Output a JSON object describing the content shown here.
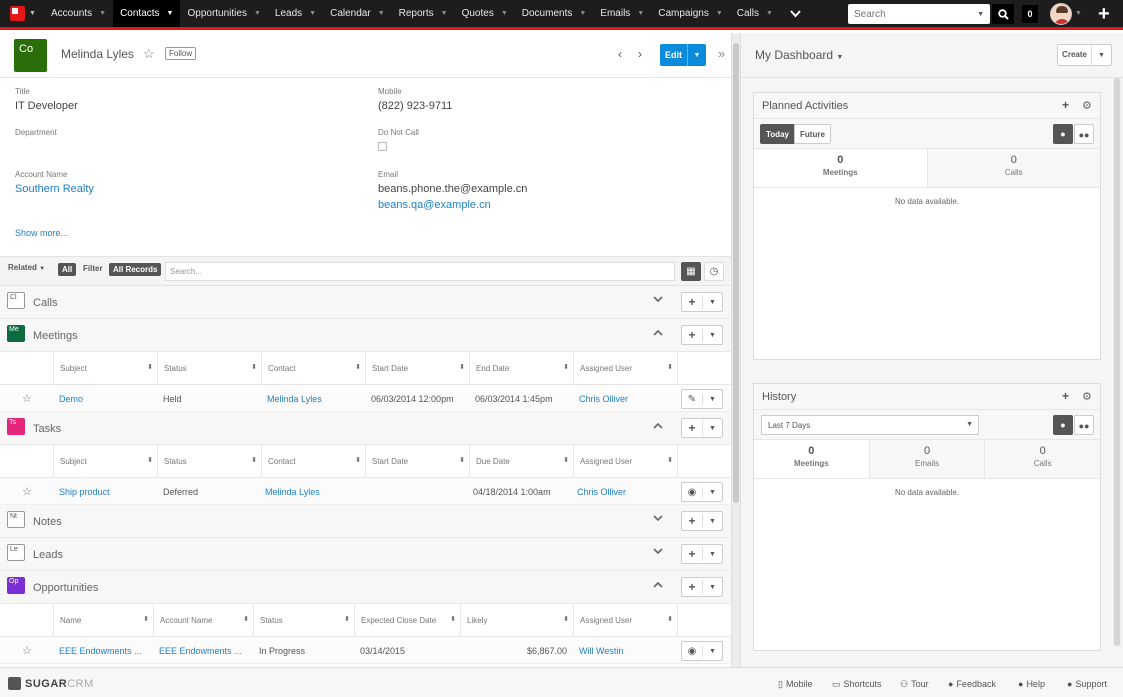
{
  "nav": {
    "items": [
      {
        "label": "Accounts",
        "active": false
      },
      {
        "label": "Contacts",
        "active": true
      },
      {
        "label": "Opportunities",
        "active": false
      },
      {
        "label": "Leads",
        "active": false
      },
      {
        "label": "Calendar",
        "active": false
      },
      {
        "label": "Reports",
        "active": false
      },
      {
        "label": "Quotes",
        "active": false
      },
      {
        "label": "Documents",
        "active": false
      },
      {
        "label": "Emails",
        "active": false
      },
      {
        "label": "Campaigns",
        "active": false
      },
      {
        "label": "Calls",
        "active": false
      }
    ],
    "search_placeholder": "Search",
    "notification_count": "0"
  },
  "record": {
    "badge": "Co",
    "name": "Melinda Lyles",
    "follow_label": "Follow",
    "edit_label": "Edit",
    "fields": {
      "title_label": "Title",
      "title_value": "IT Developer",
      "mobile_label": "Mobile",
      "mobile_value": "(822) 923-9711",
      "department_label": "Department",
      "do_not_call_label": "Do Not Call",
      "account_label": "Account Name",
      "account_value": "Southern Realty",
      "email_label": "Email",
      "email_1": "beans.phone.the@example.cn",
      "email_2": "beans.qa@example.cn"
    },
    "show_more": "Show more..."
  },
  "filter_bar": {
    "related_label": "Related",
    "related_value": "All",
    "filter_label": "Filter",
    "filter_value": "All Records",
    "search_placeholder": "Search..."
  },
  "subpanels": {
    "calls": {
      "badge": "Cl",
      "title": "Calls"
    },
    "meetings": {
      "badge": "Me",
      "title": "Meetings",
      "columns": [
        "Subject",
        "Status",
        "Contact",
        "Start Date",
        "End Date",
        "Assigned User"
      ],
      "rows": [
        {
          "subject": "Demo",
          "status": "Held",
          "contact": "Melinda Lyles",
          "start": "06/03/2014 12:00pm",
          "end": "06/03/2014 1:45pm",
          "user": "Chris Olliver"
        }
      ]
    },
    "tasks": {
      "badge": "Ts",
      "title": "Tasks",
      "columns": [
        "Subject",
        "Status",
        "Contact",
        "Start Date",
        "Due Date",
        "Assigned User"
      ],
      "rows": [
        {
          "subject": "Ship product",
          "status": "Deferred",
          "contact": "Melinda Lyles",
          "start": "",
          "due": "04/18/2014 1:00am",
          "user": "Chris Olliver"
        }
      ]
    },
    "notes": {
      "badge": "Nt",
      "title": "Notes"
    },
    "leads": {
      "badge": "Le",
      "title": "Leads"
    },
    "opportunities": {
      "badge": "Op",
      "title": "Opportunities",
      "columns": [
        "Name",
        "Account Name",
        "Status",
        "Expected Close Date",
        "Likely",
        "Assigned User"
      ],
      "rows": [
        {
          "name": "EEE Endowments ...",
          "account": "EEE Endowments ...",
          "status": "In Progress",
          "close": "03/14/2015",
          "likely": "$6,867.00",
          "user": "Will Westin"
        }
      ]
    }
  },
  "dashboard": {
    "title": "My Dashboard",
    "create_label": "Create",
    "planned": {
      "title": "Planned Activities",
      "today": "Today",
      "future": "Future",
      "tabs": [
        {
          "count": "0",
          "label": "Meetings"
        },
        {
          "count": "0",
          "label": "Calls"
        }
      ],
      "empty": "No data available."
    },
    "history": {
      "title": "History",
      "range": "Last 7 Days",
      "tabs": [
        {
          "count": "0",
          "label": "Meetings"
        },
        {
          "count": "0",
          "label": "Emails"
        },
        {
          "count": "0",
          "label": "Calls"
        }
      ],
      "empty": "No data available."
    }
  },
  "footer": {
    "brand_a": "SUGAR",
    "brand_b": "CRM",
    "links": [
      "Mobile",
      "Shortcuts",
      "Tour",
      "Feedback",
      "Help",
      "Support"
    ]
  },
  "colors": {
    "nav_bg": "#1d1d1d",
    "accent_red": "#e61718",
    "primary_blue": "#0b8bdc",
    "link_blue": "#1f7fc5",
    "contact_green": "#2a6e0a",
    "meetings_green": "#0d6b3f",
    "tasks_pink": "#e6267a",
    "opps_purple": "#7b2fd6"
  }
}
